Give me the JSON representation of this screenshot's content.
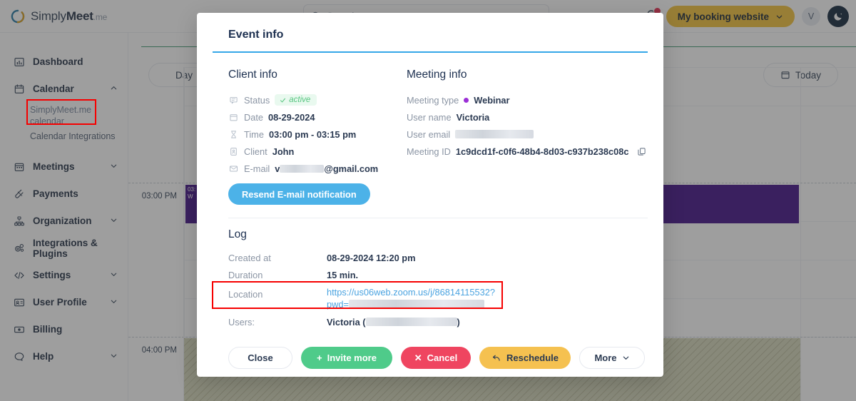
{
  "topbar": {
    "logo_name": "SimplyMeet",
    "logo_prefix": "Simply",
    "logo_suffix": "Meet",
    "logo_tld": ".me",
    "search_placeholder": "Search",
    "search_value": "",
    "booking_button": "My booking website",
    "avatar_initial": "V"
  },
  "sidebar": {
    "items": [
      {
        "label": "Dashboard",
        "icon": "chart-bar-icon",
        "expandable": false
      },
      {
        "label": "Calendar",
        "icon": "calendar-icon",
        "expandable": true,
        "expanded": true
      },
      {
        "label": "Meetings",
        "icon": "calendar-days-icon",
        "expandable": true
      },
      {
        "label": "Payments",
        "icon": "payments-icon",
        "expandable": false
      },
      {
        "label": "Organization",
        "icon": "org-chart-icon",
        "expandable": true
      },
      {
        "label": "Integrations & Plugins",
        "icon": "plugins-icon",
        "expandable": false
      },
      {
        "label": "Settings",
        "icon": "code-icon",
        "expandable": true
      },
      {
        "label": "User Profile",
        "icon": "id-card-icon",
        "expandable": true
      },
      {
        "label": "Billing",
        "icon": "banknote-icon",
        "expandable": false
      },
      {
        "label": "Help",
        "icon": "chat-icon",
        "expandable": true
      }
    ],
    "calendar_subitems": [
      {
        "label": "SimplyMeet.me calendar",
        "active": true
      },
      {
        "label": "Calendar Integrations",
        "active": false
      }
    ]
  },
  "calendar": {
    "view_button": "Day",
    "today_button": "Today",
    "time_labels": [
      "03:00 PM",
      "04:00 PM"
    ],
    "event": {
      "time": "03:",
      "title": "W"
    }
  },
  "modal": {
    "title": "Event info",
    "client_info": {
      "heading": "Client info",
      "rows": [
        {
          "icon": "speech-bubble-icon",
          "key": "Status",
          "value": "active",
          "type": "chip"
        },
        {
          "icon": "calendar-icon",
          "key": "Date",
          "value": "08-29-2024",
          "type": "text"
        },
        {
          "icon": "hourglass-icon",
          "key": "Time",
          "value": "03:00 pm - 03:15 pm",
          "type": "text"
        },
        {
          "icon": "contact-card-icon",
          "key": "Client",
          "value": "John",
          "type": "text"
        },
        {
          "icon": "envelope-icon",
          "key": "E-mail",
          "value": "@gmail.com",
          "value_prefix": "v",
          "type": "redacted-email"
        }
      ],
      "resend_button": "Resend E-mail notification"
    },
    "meeting_info": {
      "heading": "Meeting info",
      "rows": [
        {
          "key": "Meeting type",
          "value": "Webinar",
          "type": "dot-text",
          "dot_color": "#9b2fd6"
        },
        {
          "key": "User name",
          "value": "Victoria",
          "type": "text"
        },
        {
          "key": "User email",
          "value": "",
          "type": "redacted"
        },
        {
          "key": "Meeting ID",
          "value": "1c9dcd1f-c0f6-48b4-8d03-c937b238c08c",
          "type": "copy"
        }
      ]
    },
    "log": {
      "heading": "Log",
      "rows": [
        {
          "key": "Created at",
          "value": "08-29-2024 12:20 pm",
          "type": "text"
        },
        {
          "key": "Duration",
          "value": "15 min.",
          "type": "text"
        },
        {
          "key": "Location",
          "value": "https://us06web.zoom.us/j/86814115532?",
          "value2": "pwd=",
          "type": "link-redacted",
          "highlighted": true
        },
        {
          "key": "Users:",
          "value": "Victoria (",
          "value_suffix": ")",
          "type": "redacted-paren"
        }
      ]
    },
    "footer": {
      "close": "Close",
      "invite": "Invite more",
      "cancel": "Cancel",
      "reschedule": "Reschedule",
      "more": "More"
    }
  },
  "colors": {
    "accent_blue": "#35a7e8",
    "brand_gold": "#f5c542",
    "status_green": "#56c57f",
    "cancel_red": "#ef4560",
    "invite_green": "#4fcb8a",
    "event_purple": "#4a1a8c",
    "annotation_red": "#f60000"
  }
}
